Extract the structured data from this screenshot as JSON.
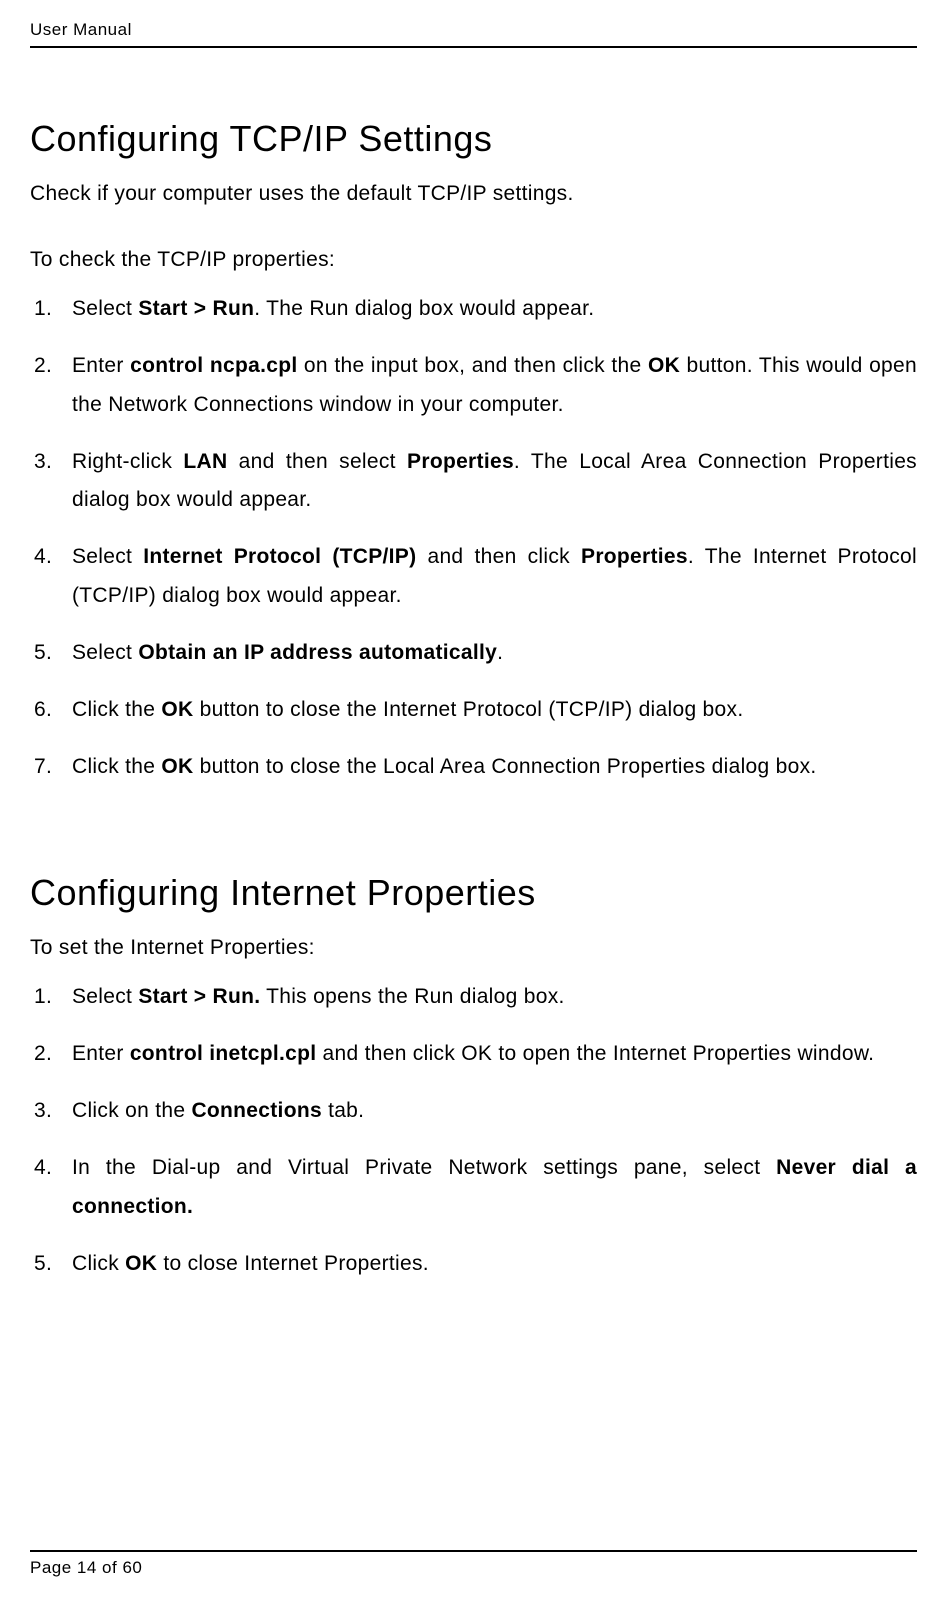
{
  "header": {
    "title": "User Manual"
  },
  "sections": [
    {
      "heading": "Configuring TCP/IP Settings",
      "intro": "Check if your computer uses the default TCP/IP settings.",
      "sub": "To check the TCP/IP properties:",
      "items": [
        {
          "pre": "Select ",
          "b1": "Start > Run",
          "post1": ". The Run dialog box would appear."
        },
        {
          "pre": "Enter ",
          "b1": "control ncpa.cpl",
          "mid1": " on the input box, and then click the ",
          "b2": "OK",
          "post2": " button. This would open the Network Connections window in your computer."
        },
        {
          "pre": "Right-click ",
          "b1": "LAN",
          "mid1": " and then select ",
          "b2": "Properties",
          "post2": ". The Local Area Connection Properties dialog box would appear."
        },
        {
          "pre": "Select ",
          "b1": "Internet Protocol (TCP/IP)",
          "mid1": " and then click ",
          "b2": "Properties",
          "post2": ". The Internet Protocol (TCP/IP) dialog box would appear."
        },
        {
          "pre": "Select ",
          "b1": "Obtain an IP address automatically",
          "post1": "."
        },
        {
          "pre": "Click the ",
          "b1": "OK",
          "post1": " button to close the Internet Protocol (TCP/IP) dialog box."
        },
        {
          "pre": "Click the ",
          "b1": "OK",
          "post1": " button to close the Local Area Connection Properties dialog box."
        }
      ]
    },
    {
      "heading": "Configuring Internet Properties",
      "sub": "To set the Internet Properties:",
      "items": [
        {
          "pre": "Select ",
          "b1": "Start > Run.",
          "post1": " This opens the Run dialog box."
        },
        {
          "pre": "Enter ",
          "b1": "control inetcpl.cpl",
          "post1": " and then click OK to open the Internet Properties window."
        },
        {
          "pre": "Click on the ",
          "b1": "Connections",
          "post1": " tab."
        },
        {
          "pre": "In the Dial-up and Virtual Private Network settings pane, select ",
          "b1": "Never dial a connection."
        },
        {
          "pre": "Click ",
          "b1": "OK",
          "post1": " to close Internet Properties."
        }
      ]
    }
  ],
  "footer": {
    "text": "Page 14 of 60"
  }
}
